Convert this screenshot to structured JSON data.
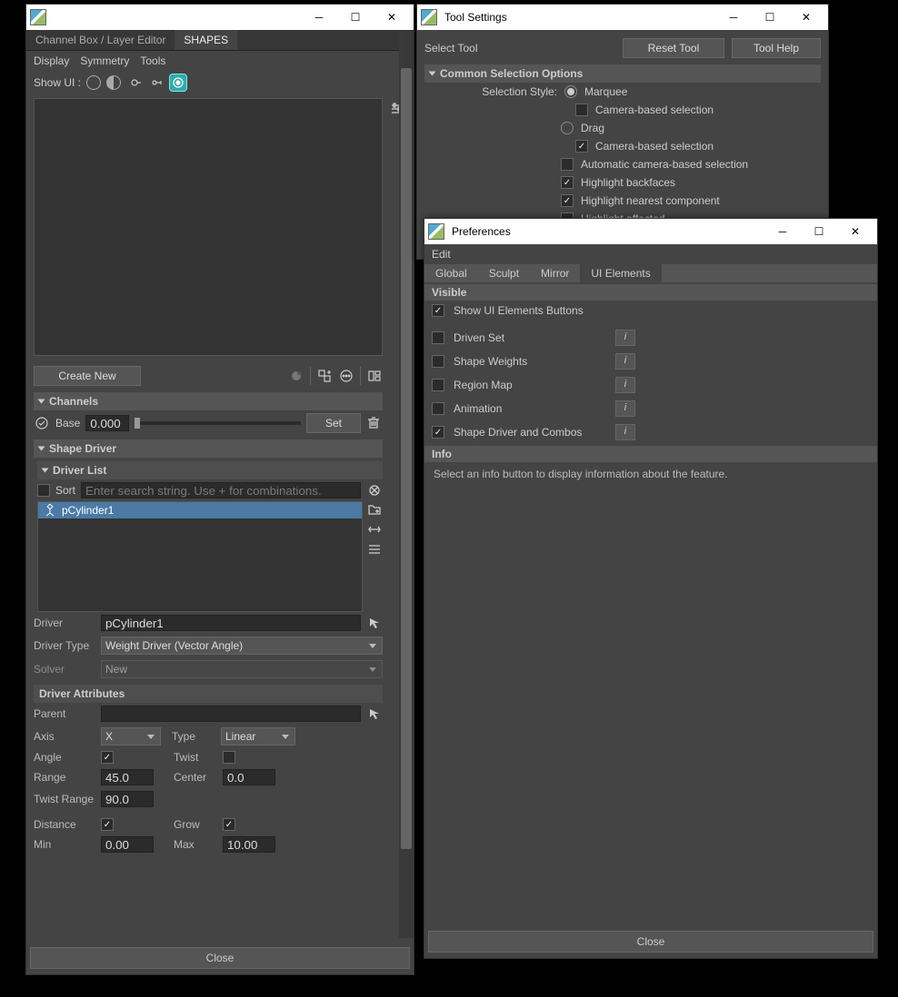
{
  "shapes_window": {
    "tabs": {
      "channel_box": "Channel Box / Layer Editor",
      "shapes": "SHAPES"
    },
    "menubar": {
      "display": "Display",
      "symmetry": "Symmetry",
      "tools": "Tools"
    },
    "show_ui_label": "Show UI :",
    "create_new": "Create New",
    "channels": {
      "title": "Channels",
      "base_label": "Base",
      "base_value": "0.000",
      "set_btn": "Set"
    },
    "shape_driver": {
      "title": "Shape Driver"
    },
    "driver_list": {
      "title": "Driver List",
      "sort_label": "Sort",
      "search_placeholder": "Enter search string. Use + for combinations.",
      "items": [
        {
          "name": "pCylinder1",
          "selected": true
        }
      ]
    },
    "driver": {
      "label": "Driver",
      "value": "pCylinder1"
    },
    "driver_type": {
      "label": "Driver Type",
      "value": "Weight Driver (Vector Angle)"
    },
    "solver": {
      "label": "Solver",
      "value": "New"
    },
    "driver_attributes": {
      "title": "Driver Attributes",
      "parent": {
        "label": "Parent",
        "value": ""
      },
      "axis": {
        "label": "Axis",
        "value": "X"
      },
      "type": {
        "label": "Type",
        "value": "Linear"
      },
      "angle": {
        "label": "Angle",
        "checked": true
      },
      "twist": {
        "label": "Twist",
        "checked": false
      },
      "range": {
        "label": "Range",
        "value": "45.0"
      },
      "center": {
        "label": "Center",
        "value": "0.0"
      },
      "twist_range": {
        "label": "Twist Range",
        "value": "90.0"
      },
      "distance": {
        "label": "Distance",
        "checked": true
      },
      "grow": {
        "label": "Grow",
        "checked": true
      },
      "min": {
        "label": "Min",
        "value": "0.00"
      },
      "max": {
        "label": "Max",
        "value": "10.00"
      }
    },
    "close": "Close"
  },
  "tool_settings": {
    "title": "Tool Settings",
    "select_tool": "Select Tool",
    "reset_tool": "Reset Tool",
    "tool_help": "Tool Help",
    "common": "Common Selection Options",
    "style_label": "Selection Style:",
    "marquee": "Marquee",
    "camera_sel1": "Camera-based selection",
    "drag": "Drag",
    "camera_sel2": "Camera-based selection",
    "auto_cam": "Automatic camera-based selection",
    "hl_back": "Highlight backfaces",
    "hl_near": "Highlight nearest component",
    "hl_aff": "Highlight affected"
  },
  "preferences": {
    "title": "Preferences",
    "edit": "Edit",
    "tabs": {
      "global": "Global",
      "sculpt": "Sculpt",
      "mirror": "Mirror",
      "ui_elements": "UI Elements"
    },
    "visible": "Visible",
    "show_ui_buttons": {
      "label": "Show UI Elements Buttons",
      "checked": true
    },
    "opts": [
      {
        "label": "Driven Set",
        "checked": false
      },
      {
        "label": "Shape Weights",
        "checked": false
      },
      {
        "label": "Region Map",
        "checked": false
      },
      {
        "label": "Animation",
        "checked": false
      },
      {
        "label": "Shape Driver and Combos",
        "checked": true
      }
    ],
    "info": {
      "title": "Info",
      "text": "Select an info button to display information about the feature."
    },
    "close": "Close"
  }
}
